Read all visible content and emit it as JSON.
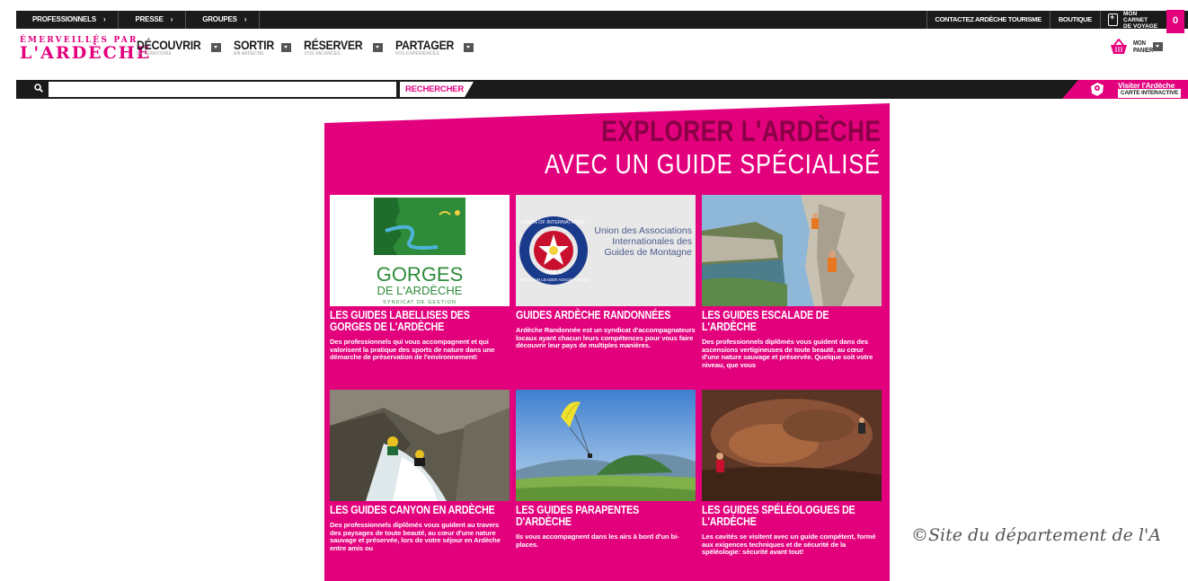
{
  "topbar": {
    "left": [
      {
        "label": "PROFESSIONNELS",
        "arrow": "›"
      },
      {
        "label": "PRESSE",
        "arrow": "›"
      },
      {
        "label": "GROUPES",
        "arrow": "›"
      }
    ],
    "contact": "CONTACTEZ ARDÈCHE TOURISME",
    "boutique": "BOUTIQUE",
    "carnet_line1": "MON CARNET",
    "carnet_line2": "DE VOYAGE",
    "carnet_count": "0"
  },
  "logo": {
    "line1": "ÉMERVEILLÉS PAR",
    "line2": "L'ARDÈCHE"
  },
  "nav": [
    {
      "label": "DÉCOUVRIR",
      "sub": "LE TERRITOIRE"
    },
    {
      "label": "SORTIR",
      "sub": "EN ARDÈCHE"
    },
    {
      "label": "RÉSERVER",
      "sub": "VOS VACANCES"
    },
    {
      "label": "PARTAGER",
      "sub": "VOS EXPÉRIENCES"
    }
  ],
  "panier": {
    "line1": "MON",
    "line2": "PANIER"
  },
  "search": {
    "value": "",
    "placeholder": "",
    "button": "RECHERCHER"
  },
  "visit": {
    "title": "Visiter l'Ardèche",
    "button": "CARTE INTERACTIVE"
  },
  "panel": {
    "heading1": "EXPLORER L'ARDÈCHE",
    "heading2": "AVEC UN GUIDE SPÉCIALISÉ"
  },
  "cards": [
    {
      "title": "LES GUIDES LABELLISES DES GORGES DE L'ARDÈCHE",
      "desc": "Des professionnels qui vous accompagnent et qui valorisent la pratique des sports de nature dans une démarche de préservation de l'environnement!",
      "logo_line1": "GORGES",
      "logo_line2": "DE L'ARDÈCHE",
      "logo_line3": "SYNDICAT DE GESTION"
    },
    {
      "title": "GUIDES ARDÈCHE RANDONNÉES",
      "desc": "Ardèche Randonnée est un syndicat d'accompagnateurs locaux ayant chacun leurs compétences pour vous faire découvrir leur pays de multiples manières.",
      "logo_text": "Union des Associations Internationales des Guides de Montagne",
      "logo_badge": "UIMLA",
      "logo_ring_top": "UNION OF INTERNATIONAL",
      "logo_ring_bottom": "MOUNTAIN LEADER ASSOCIATIONS"
    },
    {
      "title": "LES GUIDES ESCALADE DE L'ARDÈCHE",
      "desc": "Des professionnels diplômés vous guident dans des ascensions vertigineuses de toute beauté, au cœur d'une nature sauvage et préservée. Quelque soit votre niveau, que vous"
    },
    {
      "title": "LES GUIDES CANYON EN ARDÈCHE",
      "desc": "Des professionnels diplômés vous guident au travers des paysages de toute beauté, au cœur d'une nature sauvage et préservée, lors de votre séjour en Ardèche entre amis ou"
    },
    {
      "title": "LES GUIDES PARAPENTES D'ARDÈCHE",
      "desc": "Ils vous accompagnent dans les airs à bord d'un bi-places."
    },
    {
      "title": "LES GUIDES SPÉLÉOLOGUES DE L'ARDÈCHE",
      "desc": "Les cavités se visitent avec un guide compétent, formé aux exigences techniques et de sécurité de la spéléologie: sécurité avant tout!"
    }
  ],
  "copyright": "©Site du département de l'A",
  "colors": {
    "brand": "#e3007d",
    "dark": "#1b1b1b",
    "heading_dark": "#8a0046"
  }
}
